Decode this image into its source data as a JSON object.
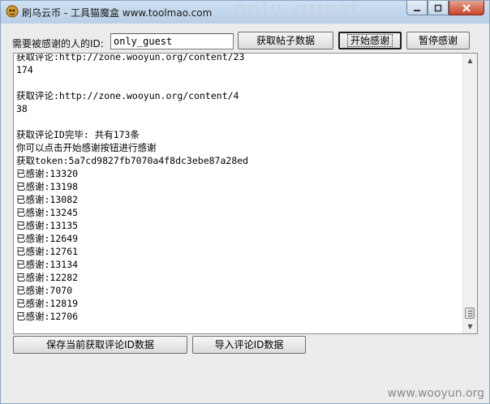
{
  "window": {
    "title": "刷乌云币 - 工具猫魔盒 www.toolmao.com",
    "ghost_title": "only_guest",
    "icon": "app-logo-icon",
    "minimize_icon": "minimize-icon",
    "maximize_icon": "maximize-icon",
    "close_icon": "close-icon"
  },
  "form": {
    "uid_label": "需要被感谢的人的ID:",
    "uid_value": "only_guest"
  },
  "toolbar": {
    "fetch_posts_label": "获取帖子数据",
    "start_thanks_label": "开始感谢",
    "pause_thanks_label": "暂停感谢"
  },
  "log": {
    "lines": [
      "获取评论:http://zone.wooyun.org/content/23",
      "174",
      "",
      "获取评论:http://zone.wooyun.org/content/4",
      "38",
      "",
      "获取评论ID完毕: 共有173条",
      "你可以点击开始感谢按钮进行感谢",
      "获取token:5a7cd9827fb7070a4f8dc3ebe87a28ed",
      "已感谢:13320",
      "已感谢:13198",
      "已感谢:13082",
      "已感谢:13245",
      "已感谢:13135",
      "已感谢:12649",
      "已感谢:12761",
      "已感谢:13134",
      "已感谢:12282",
      "已感谢:7070",
      "已感谢:12819",
      "已感谢:12706"
    ]
  },
  "bottom": {
    "save_label": "保存当前获取评论ID数据",
    "import_label": "导入评论ID数据"
  },
  "watermark": "www.wooyun.org",
  "colors": {
    "titlebar": "#c4d8ec",
    "window_bg": "#ececec",
    "close_button": "#c7452b"
  }
}
